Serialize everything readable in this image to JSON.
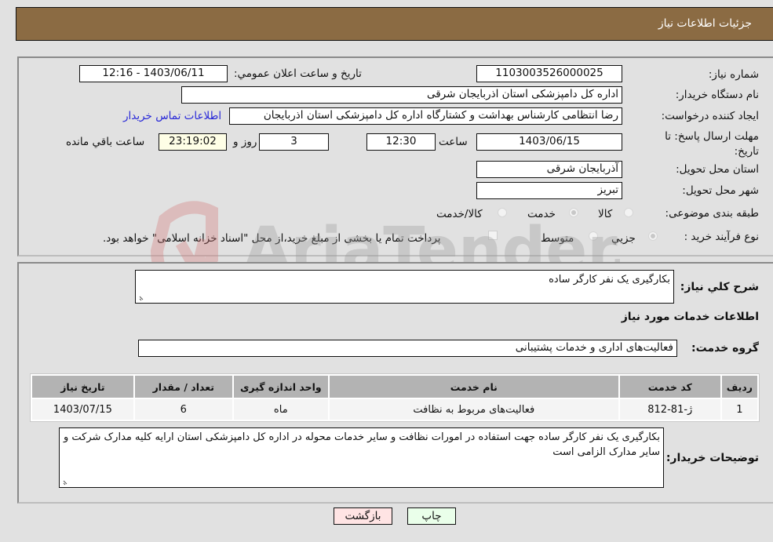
{
  "header": {
    "title": "جزئیات اطلاعات نیاز"
  },
  "form": {
    "need_number_label": "شماره نیاز:",
    "need_number": "1103003526000025",
    "announce_label": "تاریخ و ساعت اعلان عمومي:",
    "announce_value": "1403/06/11 - 12:16",
    "buyer_org_label": "نام دستگاه خریدار:",
    "buyer_org": "اداره کل دامپزشکی استان اذربایجان شرقی",
    "creator_label": "ایجاد کننده درخواست:",
    "creator": "رضا انتظامی کارشناس بهداشت و کشتارگاه اداره کل دامپزشکی استان اذربایجان",
    "contact_link": "اطلاعات تماس خریدار",
    "deadline_label": "مهلت ارسال پاسخ: تا تاریخ:",
    "deadline_date": "1403/06/15",
    "time_label": "ساعت",
    "deadline_time": "12:30",
    "days_value": "3",
    "days_label": "روز و",
    "remaining_time": "23:19:02",
    "remaining_label": "ساعت باقي مانده",
    "province_label": "استان محل تحویل:",
    "province": "آذربایجان شرقی",
    "city_label": "شهر محل تحویل:",
    "city": "تبریز",
    "category_label": "طبقه بندی موضوعی:",
    "category_options": [
      {
        "label": "کالا",
        "checked": false
      },
      {
        "label": "خدمت",
        "checked": true
      },
      {
        "label": "کالا/خدمت",
        "checked": false
      }
    ],
    "process_label": "نوع فرآیند خرید :",
    "process_options": [
      {
        "label": "جزيي",
        "checked": true
      },
      {
        "label": "متوسط",
        "checked": false
      }
    ],
    "payment_note": "پرداخت تمام یا بخشی از مبلغ خرید،از محل \"اسناد خزانه اسلامی\" خواهد بود."
  },
  "details": {
    "summary_label": "شرح کلي نیاز:",
    "summary": "بکارگیری یک نفر کارگر ساده",
    "services_heading": "اطلاعات خدمات مورد نیاز",
    "service_group_label": "گروه خدمت:",
    "service_group": "فعالیت‌های اداری و خدمات پشتیبانی",
    "table": {
      "headers": [
        "ردیف",
        "کد خدمت",
        "نام خدمت",
        "واحد اندازه گیری",
        "تعداد / مقدار",
        "تاریخ نیاز"
      ],
      "rows": [
        [
          "1",
          "ژ-81-812",
          "فعالیت‌های مربوط به نظافت",
          "ماه",
          "6",
          "1403/07/15"
        ]
      ]
    },
    "buyer_notes_label": "توضیحات خریدار:",
    "buyer_notes": "بکارگیری یک نفر کارگر ساده جهت استفاده در امورات نظافت و سایر خدمات محوله در اداره کل دامپزشکی استان ارایه کلیه مدارک شرکت و سایر مدارک الزامی است"
  },
  "buttons": {
    "print": "چاپ",
    "back": "بازگشت"
  },
  "watermark": {
    "text": "AriaTender.neT"
  }
}
